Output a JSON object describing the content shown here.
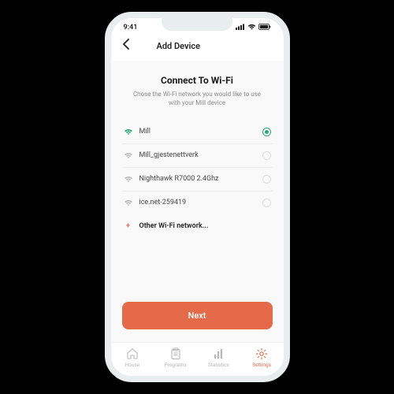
{
  "status": {
    "time": "9:41"
  },
  "nav": {
    "title": "Add Device"
  },
  "page": {
    "title": "Connect To Wi-Fi",
    "subtitle": "Chose the Wi-Fi network you would like to use with your Mill device"
  },
  "wifi": {
    "networks": [
      {
        "name": "Mill",
        "selected": true
      },
      {
        "name": "Mill_gjestenettverk",
        "selected": false
      },
      {
        "name": "Nighthawk R7000 2.4Ghz",
        "selected": false
      },
      {
        "name": "ice.net-259419",
        "selected": false
      }
    ],
    "other_label": "Other Wi-Fi network..."
  },
  "buttons": {
    "next": "Next"
  },
  "tabs": {
    "items": [
      {
        "label": "House"
      },
      {
        "label": "Programs"
      },
      {
        "label": "Statistics"
      },
      {
        "label": "Settings"
      }
    ],
    "active_index": 3
  },
  "colors": {
    "accent": "#e46a4a",
    "success": "#2aa876"
  }
}
